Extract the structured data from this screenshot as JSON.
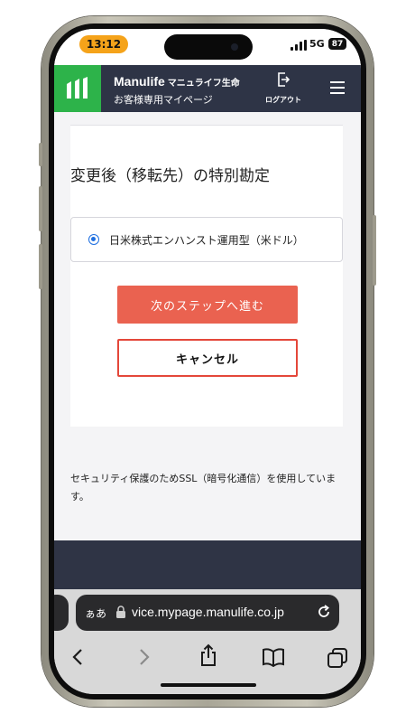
{
  "status_bar": {
    "time": "13:12",
    "network": "5G",
    "battery": "87"
  },
  "header": {
    "brand": "Manulife",
    "brand_jp": "マニュライフ生命",
    "subtitle": "お客様専用マイページ",
    "logout_label": "ログアウト",
    "logo_icon": "manulife-logo-icon",
    "menu_icon": "hamburger-menu-icon"
  },
  "main": {
    "heading": "変更後（移転先）の特別勘定",
    "option_label": "日米株式エンハンスト運用型（米ドル）",
    "next_button": "次のステップへ進む",
    "cancel_button": "キャンセル",
    "ssl_note": "セキュリティ保護のためSSL（暗号化通信）を使用しています。"
  },
  "browser": {
    "reader_label": "ぁあ",
    "url": "vice.mypage.manulife.co.jp",
    "toolbar_icons": [
      "back-icon",
      "forward-icon",
      "share-icon",
      "bookmarks-icon",
      "tabs-icon"
    ]
  },
  "colors": {
    "header_bg": "#2e3446",
    "logo_green": "#2db34a",
    "primary_button": "#ea6250",
    "cancel_border": "#e4473a",
    "radio_blue": "#1f6fe0",
    "status_time_pill": "#f5a31a"
  }
}
